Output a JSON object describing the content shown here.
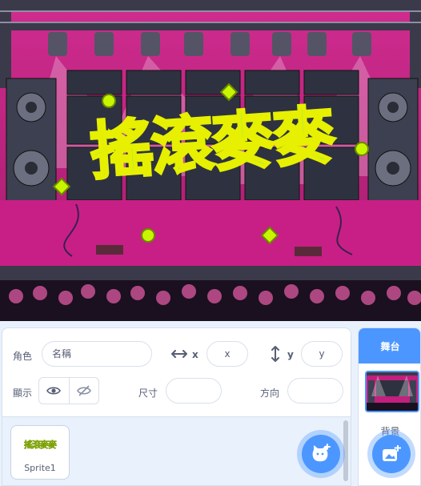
{
  "stage": {
    "title_text": "搖滾麥麥"
  },
  "sprite_info": {
    "sprite_label": "角色",
    "name_placeholder": "名稱",
    "x_label": "x",
    "x_placeholder": "x",
    "y_label": "y",
    "y_placeholder": "y",
    "show_label": "顯示",
    "size_label": "尺寸",
    "direction_label": "方向"
  },
  "sprites": [
    {
      "name": "Sprite1"
    }
  ],
  "stage_panel": {
    "header": "舞台",
    "backdrops_label": "背景"
  },
  "colors": {
    "accent": "#4c97ff",
    "stage_bg": "#b8207a",
    "title_fill": "#3ce6c8",
    "title_outline": "#e6f000"
  }
}
